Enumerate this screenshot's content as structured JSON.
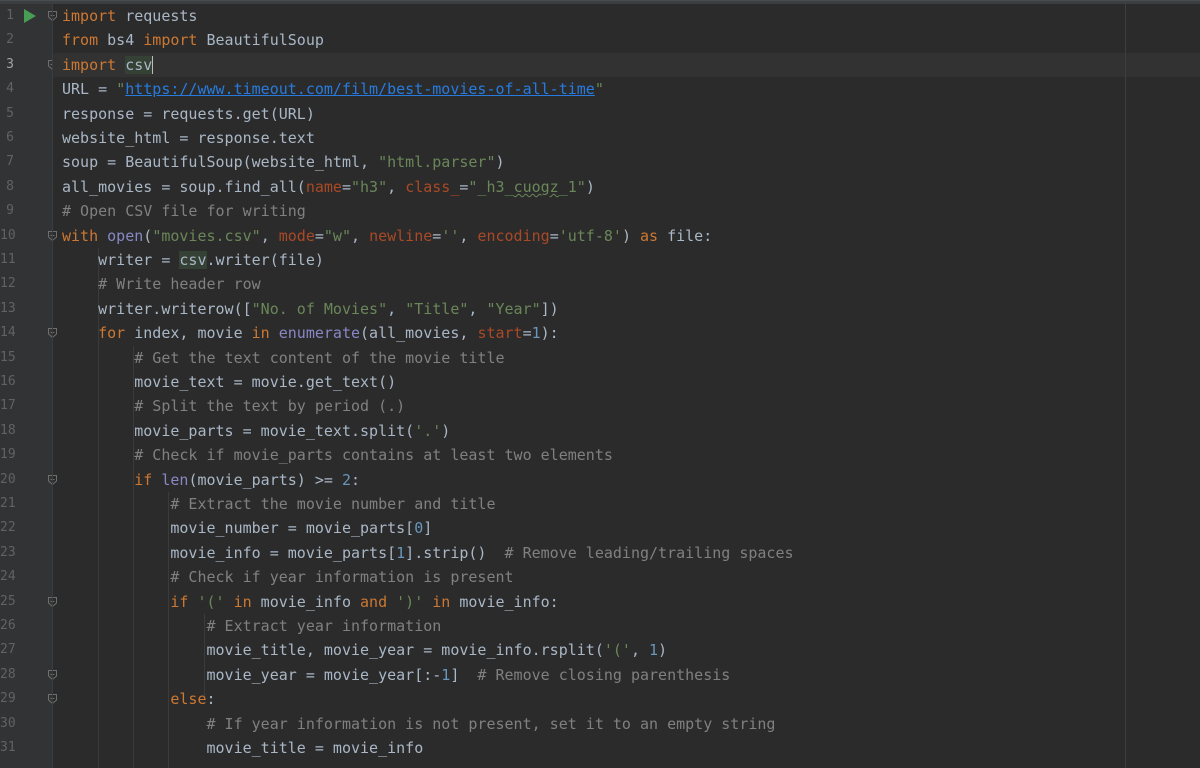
{
  "editor": {
    "file_language": "python",
    "current_line": 3,
    "lines": [
      {
        "num": "1",
        "tokens": [
          {
            "t": "import",
            "c": "kw"
          },
          {
            "t": " requests",
            "c": "plain"
          }
        ]
      },
      {
        "num": "2",
        "tokens": [
          {
            "t": "from",
            "c": "kw"
          },
          {
            "t": " bs4 ",
            "c": "plain"
          },
          {
            "t": "import",
            "c": "kw"
          },
          {
            "t": " BeautifulSoup",
            "c": "plain"
          }
        ]
      },
      {
        "num": "3",
        "tokens": [
          {
            "t": "import",
            "c": "kw"
          },
          {
            "t": " ",
            "c": "plain"
          },
          {
            "t": "csv",
            "c": "plain hl"
          }
        ]
      },
      {
        "num": "4",
        "tokens": [
          {
            "t": "URL = ",
            "c": "plain"
          },
          {
            "t": "\"",
            "c": "str"
          },
          {
            "t": "https://www.timeout.com/film/best-movies-of-all-time",
            "c": "str url"
          },
          {
            "t": "\"",
            "c": "str"
          }
        ]
      },
      {
        "num": "5",
        "tokens": [
          {
            "t": "response = requests.get(URL)",
            "c": "plain"
          }
        ]
      },
      {
        "num": "6",
        "tokens": [
          {
            "t": "website_html = response.text",
            "c": "plain"
          }
        ]
      },
      {
        "num": "7",
        "tokens": [
          {
            "t": "soup = BeautifulSoup(website_html, ",
            "c": "plain"
          },
          {
            "t": "\"html.parser\"",
            "c": "str"
          },
          {
            "t": ")",
            "c": "plain"
          }
        ]
      },
      {
        "num": "8",
        "tokens": [
          {
            "t": "all_movies = soup.find_all(",
            "c": "plain"
          },
          {
            "t": "name",
            "c": "param"
          },
          {
            "t": "=",
            "c": "plain"
          },
          {
            "t": "\"h3\"",
            "c": "str"
          },
          {
            "t": ", ",
            "c": "plain"
          },
          {
            "t": "class_",
            "c": "param"
          },
          {
            "t": "=",
            "c": "plain"
          },
          {
            "t": "\"_h3_",
            "c": "str"
          },
          {
            "t": "cuogz",
            "c": "str squiggle"
          },
          {
            "t": "_1\"",
            "c": "str"
          },
          {
            "t": ")",
            "c": "plain"
          }
        ]
      },
      {
        "num": "9",
        "tokens": [
          {
            "t": "# Open CSV file for writing",
            "c": "cmt"
          }
        ]
      },
      {
        "num": "10",
        "tokens": [
          {
            "t": "with ",
            "c": "kw"
          },
          {
            "t": "open",
            "c": "builtin"
          },
          {
            "t": "(",
            "c": "plain"
          },
          {
            "t": "\"movies.csv\"",
            "c": "str"
          },
          {
            "t": ", ",
            "c": "plain"
          },
          {
            "t": "mode",
            "c": "param"
          },
          {
            "t": "=",
            "c": "plain"
          },
          {
            "t": "\"w\"",
            "c": "str"
          },
          {
            "t": ", ",
            "c": "plain"
          },
          {
            "t": "newline",
            "c": "param"
          },
          {
            "t": "=",
            "c": "plain"
          },
          {
            "t": "''",
            "c": "str"
          },
          {
            "t": ", ",
            "c": "plain"
          },
          {
            "t": "encoding",
            "c": "param"
          },
          {
            "t": "=",
            "c": "plain"
          },
          {
            "t": "'utf-8'",
            "c": "str"
          },
          {
            "t": ") ",
            "c": "plain"
          },
          {
            "t": "as",
            "c": "kw"
          },
          {
            "t": " file:",
            "c": "plain"
          }
        ]
      },
      {
        "num": "11",
        "tokens": [
          {
            "t": "    writer = ",
            "c": "plain"
          },
          {
            "t": "csv",
            "c": "plain hl"
          },
          {
            "t": ".writer(file)",
            "c": "plain"
          }
        ]
      },
      {
        "num": "12",
        "tokens": [
          {
            "t": "    ",
            "c": "plain"
          },
          {
            "t": "# Write header row",
            "c": "cmt"
          }
        ]
      },
      {
        "num": "13",
        "tokens": [
          {
            "t": "    writer.writerow([",
            "c": "plain"
          },
          {
            "t": "\"No. of Movies\"",
            "c": "str"
          },
          {
            "t": ", ",
            "c": "plain"
          },
          {
            "t": "\"Title\"",
            "c": "str"
          },
          {
            "t": ", ",
            "c": "plain"
          },
          {
            "t": "\"Year\"",
            "c": "str"
          },
          {
            "t": "])",
            "c": "plain"
          }
        ]
      },
      {
        "num": "14",
        "tokens": [
          {
            "t": "    ",
            "c": "plain"
          },
          {
            "t": "for",
            "c": "kw"
          },
          {
            "t": " index, movie ",
            "c": "plain"
          },
          {
            "t": "in",
            "c": "kw"
          },
          {
            "t": " ",
            "c": "plain"
          },
          {
            "t": "enumerate",
            "c": "builtin"
          },
          {
            "t": "(all_movies, ",
            "c": "plain"
          },
          {
            "t": "start",
            "c": "param"
          },
          {
            "t": "=",
            "c": "plain"
          },
          {
            "t": "1",
            "c": "num"
          },
          {
            "t": "):",
            "c": "plain"
          }
        ]
      },
      {
        "num": "15",
        "tokens": [
          {
            "t": "        ",
            "c": "plain"
          },
          {
            "t": "# Get the text content of the movie title",
            "c": "cmt"
          }
        ]
      },
      {
        "num": "16",
        "tokens": [
          {
            "t": "        movie_text = movie.get_text()",
            "c": "plain"
          }
        ]
      },
      {
        "num": "17",
        "tokens": [
          {
            "t": "        ",
            "c": "plain"
          },
          {
            "t": "# Split the text by period (.)",
            "c": "cmt"
          }
        ]
      },
      {
        "num": "18",
        "tokens": [
          {
            "t": "        movie_parts = movie_text.split(",
            "c": "plain"
          },
          {
            "t": "'.'",
            "c": "str"
          },
          {
            "t": ")",
            "c": "plain"
          }
        ]
      },
      {
        "num": "19",
        "tokens": [
          {
            "t": "        ",
            "c": "plain"
          },
          {
            "t": "# Check if movie_parts contains at least two elements",
            "c": "cmt"
          }
        ]
      },
      {
        "num": "20",
        "tokens": [
          {
            "t": "        ",
            "c": "plain"
          },
          {
            "t": "if",
            "c": "kw"
          },
          {
            "t": " ",
            "c": "plain"
          },
          {
            "t": "len",
            "c": "builtin"
          },
          {
            "t": "(movie_parts) >= ",
            "c": "plain"
          },
          {
            "t": "2",
            "c": "num"
          },
          {
            "t": ":",
            "c": "plain"
          }
        ]
      },
      {
        "num": "21",
        "tokens": [
          {
            "t": "            ",
            "c": "plain"
          },
          {
            "t": "# Extract the movie number and title",
            "c": "cmt"
          }
        ]
      },
      {
        "num": "22",
        "tokens": [
          {
            "t": "            movie_number = movie_parts[",
            "c": "plain"
          },
          {
            "t": "0",
            "c": "num"
          },
          {
            "t": "]",
            "c": "plain"
          }
        ]
      },
      {
        "num": "23",
        "tokens": [
          {
            "t": "            movie_info = movie_parts[",
            "c": "plain"
          },
          {
            "t": "1",
            "c": "num"
          },
          {
            "t": "].strip()  ",
            "c": "plain"
          },
          {
            "t": "# Remove leading/trailing spaces",
            "c": "cmt"
          }
        ]
      },
      {
        "num": "24",
        "tokens": [
          {
            "t": "            ",
            "c": "plain"
          },
          {
            "t": "# Check if year information is present",
            "c": "cmt"
          }
        ]
      },
      {
        "num": "25",
        "tokens": [
          {
            "t": "            ",
            "c": "plain"
          },
          {
            "t": "if",
            "c": "kw"
          },
          {
            "t": " ",
            "c": "plain"
          },
          {
            "t": "'('",
            "c": "str"
          },
          {
            "t": " ",
            "c": "plain"
          },
          {
            "t": "in",
            "c": "kw"
          },
          {
            "t": " movie_info ",
            "c": "plain"
          },
          {
            "t": "and",
            "c": "kw"
          },
          {
            "t": " ",
            "c": "plain"
          },
          {
            "t": "')'",
            "c": "str"
          },
          {
            "t": " ",
            "c": "plain"
          },
          {
            "t": "in",
            "c": "kw"
          },
          {
            "t": " movie_info:",
            "c": "plain"
          }
        ]
      },
      {
        "num": "26",
        "tokens": [
          {
            "t": "                ",
            "c": "plain"
          },
          {
            "t": "# Extract year information",
            "c": "cmt"
          }
        ]
      },
      {
        "num": "27",
        "tokens": [
          {
            "t": "                movie_title, movie_year = movie_info.rsplit(",
            "c": "plain"
          },
          {
            "t": "'('",
            "c": "str"
          },
          {
            "t": ", ",
            "c": "plain"
          },
          {
            "t": "1",
            "c": "num"
          },
          {
            "t": ")",
            "c": "plain"
          }
        ]
      },
      {
        "num": "28",
        "tokens": [
          {
            "t": "                movie_year = movie_year[:-",
            "c": "plain"
          },
          {
            "t": "1",
            "c": "num"
          },
          {
            "t": "]  ",
            "c": "plain"
          },
          {
            "t": "# Remove closing parenthesis",
            "c": "cmt"
          }
        ]
      },
      {
        "num": "29",
        "tokens": [
          {
            "t": "            ",
            "c": "plain"
          },
          {
            "t": "else",
            "c": "kw"
          },
          {
            "t": ":",
            "c": "plain"
          }
        ]
      },
      {
        "num": "30",
        "tokens": [
          {
            "t": "                ",
            "c": "plain"
          },
          {
            "t": "# If year information is not present, set it to an empty string",
            "c": "cmt"
          }
        ]
      },
      {
        "num": "31",
        "tokens": [
          {
            "t": "                movie_title = movie_info",
            "c": "plain"
          }
        ]
      }
    ],
    "run_icon_line": 1,
    "fold_lines": [
      1,
      3,
      10,
      14,
      20,
      25,
      28,
      29
    ]
  }
}
